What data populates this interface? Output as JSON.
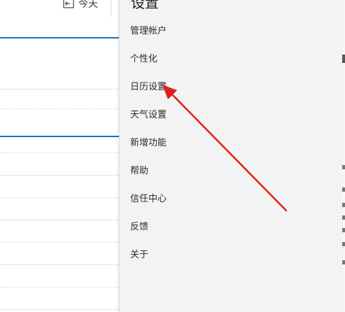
{
  "toolbar": {
    "today_label": "今天",
    "today_icon": "calendar-today-icon"
  },
  "settings": {
    "title": "设置",
    "items": [
      {
        "label": "管理帐户"
      },
      {
        "label": "个性化"
      },
      {
        "label": "日历设置"
      },
      {
        "label": "天气设置"
      },
      {
        "label": "新增功能"
      },
      {
        "label": "帮助"
      },
      {
        "label": "信任中心"
      },
      {
        "label": "反馈"
      },
      {
        "label": "关于"
      }
    ]
  },
  "annotation": {
    "color": "#e0201c",
    "points_to": "日历设置"
  },
  "colors": {
    "accent": "#1f6fbf",
    "panel_bg": "#f3f3f3"
  }
}
